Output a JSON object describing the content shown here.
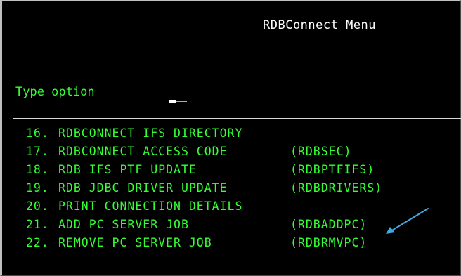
{
  "screen": {
    "title": "RDBConnect Menu",
    "prompt_label": "Type option",
    "option_value": ""
  },
  "menu": {
    "items": [
      {
        "number": "16.",
        "label": "RDBCONNECT IFS DIRECTORY",
        "command": ""
      },
      {
        "number": "17.",
        "label": "RDBCONNECT ACCESS CODE",
        "command": "(RDBSEC)"
      },
      {
        "number": "18.",
        "label": "RDB IFS PTF UPDATE",
        "command": "(RDBPTFIFS)"
      },
      {
        "number": "19.",
        "label": "RDB JDBC DRIVER UPDATE",
        "command": "(RDBDRIVERS)"
      },
      {
        "number": "20.",
        "label": "PRINT CONNECTION DETAILS",
        "command": ""
      },
      {
        "number": "21.",
        "label": "ADD PC SERVER JOB",
        "command": "(RDBADDPC)"
      },
      {
        "number": "22.",
        "label": "REMOVE PC SERVER JOB",
        "command": "(RDBRMVPC)"
      }
    ]
  },
  "colors": {
    "background": "#000000",
    "text_green": "#33ff33",
    "text_white": "#ffffff",
    "annotation_arrow": "#3fa9e0"
  },
  "annotation": {
    "icon": "pointer-arrow-icon"
  }
}
